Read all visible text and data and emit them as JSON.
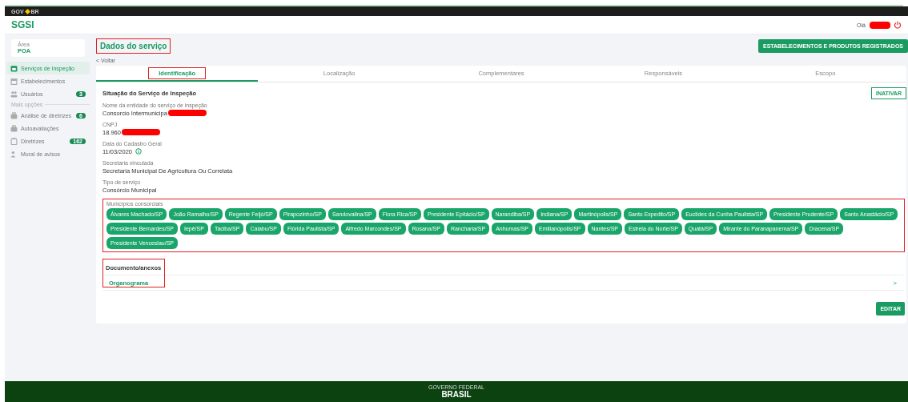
{
  "gov_bar": {
    "left": "GOV",
    "right": "BR"
  },
  "header": {
    "app_name": "SGSI",
    "greeting": "Olá",
    "greeting_redacted": true
  },
  "sidebar": {
    "area_label": "Área",
    "area_value": "POA",
    "items": [
      {
        "label": "Serviços de Inspeção",
        "selected": true
      },
      {
        "label": "Estabelecimentos",
        "selected": false
      },
      {
        "label": "Usuários",
        "selected": false,
        "badge": "3"
      }
    ],
    "section_label": "Mais opções",
    "more_items": [
      {
        "label": "Análise de diretrizes",
        "selected": false,
        "badge": "6"
      },
      {
        "label": "Autoavaliações",
        "selected": false
      },
      {
        "label": "Diretrizes",
        "selected": false,
        "badge": "162"
      },
      {
        "label": "Mural de avisos",
        "selected": false
      }
    ]
  },
  "page": {
    "title": "Dados do serviço",
    "title_highlighted": true,
    "top_button": "ESTABELECIMENTOS E PRODUTOS REGISTRADOS",
    "back_arrow": "<",
    "back": "Voltar"
  },
  "tabs": [
    {
      "label": "Identificação",
      "selected": true,
      "highlighted": true
    },
    {
      "label": "Localização",
      "selected": false,
      "highlighted": false
    },
    {
      "label": "Complementares",
      "selected": false,
      "highlighted": false
    },
    {
      "label": "Responsáveis",
      "selected": false,
      "highlighted": false
    },
    {
      "label": "Escopo",
      "selected": false,
      "highlighted": false
    }
  ],
  "section_title": "Situação do Serviço de Inspeção",
  "inactivate_button": "INATIVAR",
  "fields": [
    {
      "label": "Nome da entidade do serviço de inspeção",
      "value": "Consorcio Intermunicipa",
      "redacted": true
    },
    {
      "label": "CNPJ",
      "value": "18.960",
      "redacted": true
    },
    {
      "label": "Data do Cadastro Geral",
      "value": "11/03/2020",
      "redacted": false,
      "info": true
    },
    {
      "label": "Secretaria vinculada",
      "value": "Secretaria Municipal De Agricultura Ou Correlata",
      "redacted": false
    },
    {
      "label": "Tipo de serviço",
      "value": "Consórcio Municipal",
      "redacted": false
    }
  ],
  "municipalities": {
    "label": "Municípios consorciais",
    "highlighted": true,
    "items": [
      "Álvares Machado/SP",
      "João Ramalho/SP",
      "Regente Feijó/SP",
      "Pirapozinho/SP",
      "Sandovalina/SP",
      "Flora Rica/SP",
      "Presidente Epitácio/SP",
      "Narandiba/SP",
      "Indiana/SP",
      "Martinópolis/SP",
      "Santo Expedito/SP",
      "Euclides da Cunha Paulista/SP",
      "Presidente Prudente/SP",
      "Santo Anastácio/SP",
      "Presidente Bernardes/SP",
      "Iepê/SP",
      "Taciba/SP",
      "Caiabu/SP",
      "Flórida Paulista/SP",
      "Alfredo Marcondes/SP",
      "Rosana/SP",
      "Rancharia/SP",
      "Anhumas/SP",
      "Emilianópolis/SP",
      "Nantes/SP",
      "Estrela do Norte/SP",
      "Quatá/SP",
      "Mirante do Paranapanema/SP",
      "Dracena/SP",
      "Presidente Venceslau/SP"
    ]
  },
  "documents": {
    "label": "Documento/anexos",
    "highlighted": true,
    "items": [
      {
        "name": "Organograma",
        "arrow": ">"
      }
    ]
  },
  "edit_button": "EDITAR",
  "footer": {
    "top": "GOVERNO FEDERAL",
    "brand": "BRASIL"
  }
}
